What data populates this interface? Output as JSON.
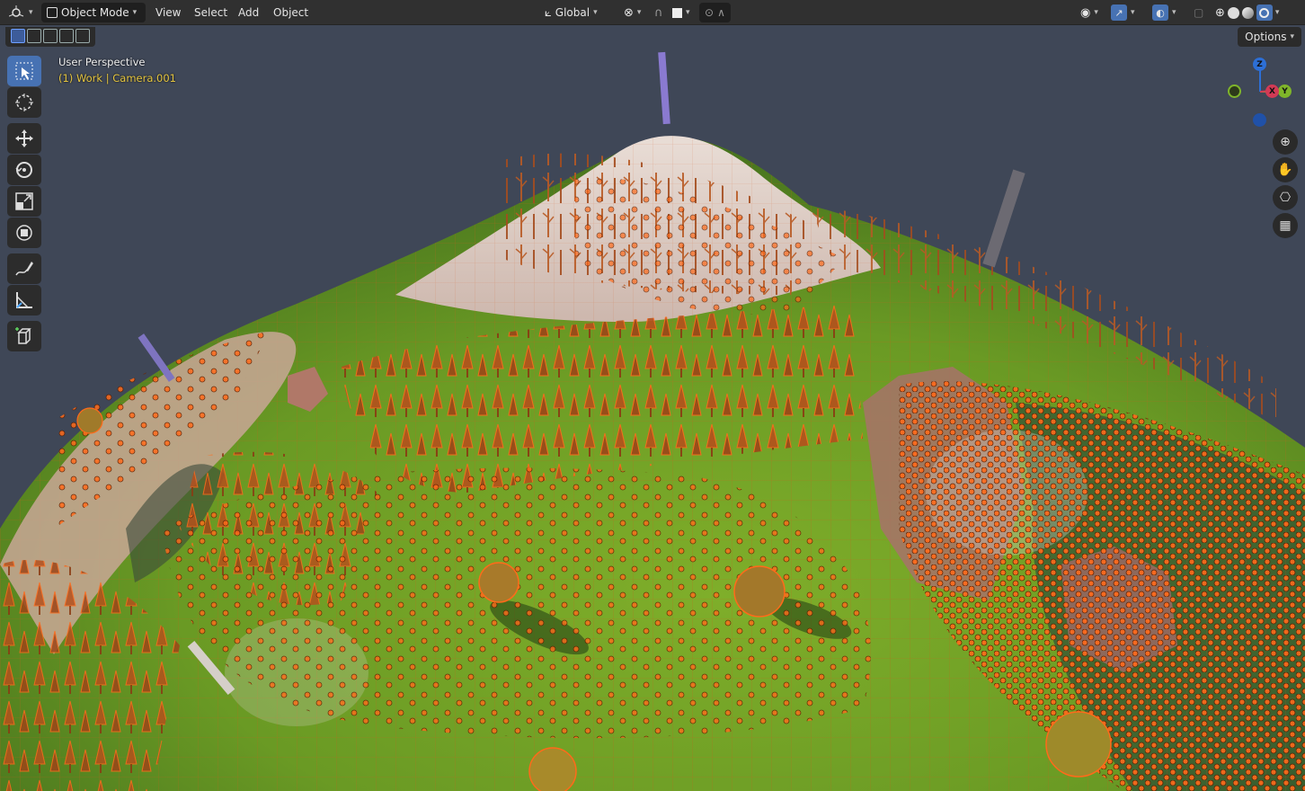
{
  "header": {
    "editor_type_icon": "editor-type-icon",
    "mode": "Object Mode",
    "menus": [
      "View",
      "Select",
      "Add",
      "Object"
    ],
    "transform_orientation": "Global",
    "options_label": "Options"
  },
  "viewport": {
    "perspective_label": "User Perspective",
    "collection_label": "(1) Work | Camera.001",
    "gizmo": {
      "z": "Z",
      "y": "Y",
      "x": "X"
    }
  },
  "toolbar": {
    "tools": [
      "select-box-icon",
      "cursor-icon",
      "move-icon",
      "rotate-icon",
      "scale-icon",
      "transform-icon",
      "annotate-icon",
      "measure-icon",
      "add-cube-icon"
    ]
  },
  "colors": {
    "accent": "#4772b3",
    "selection_orange": "#ff6a1a",
    "background": "#3f4757"
  }
}
